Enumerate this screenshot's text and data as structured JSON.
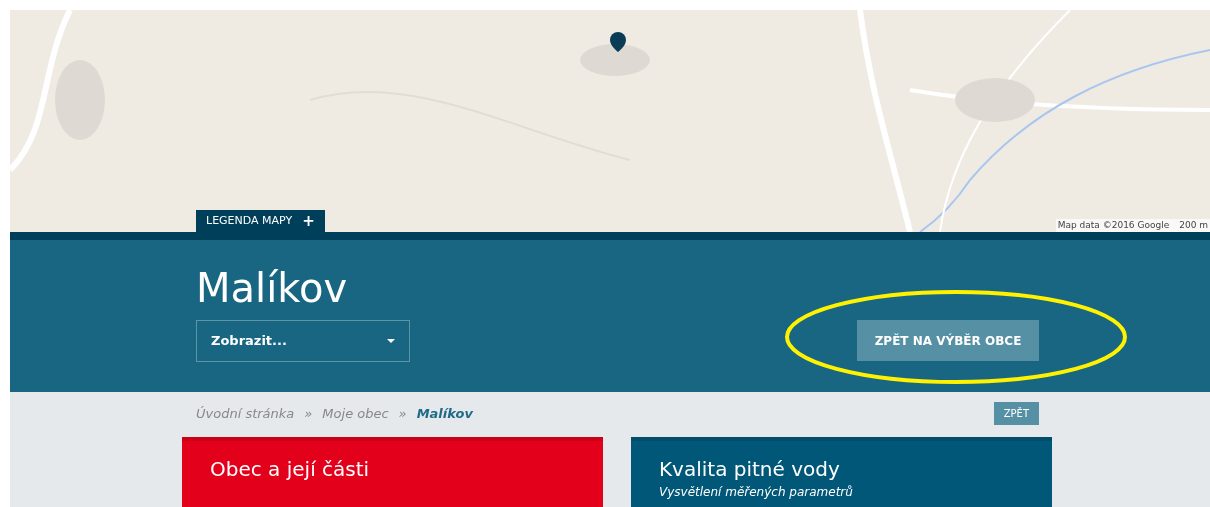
{
  "map": {
    "legend_tab": {
      "label": "LEGENDA MAPY",
      "icon": "+"
    },
    "attribution": "Map data ©2016 Google",
    "scale": "200 m"
  },
  "header": {
    "title": "Malíkov",
    "dropdown": {
      "value": "Zobrazit..."
    },
    "back_button": "ZPĚT NA VÝBĚR OBCE",
    "highlighted": true
  },
  "breadcrumb": {
    "items": [
      {
        "label": "Úvodní stránka",
        "current": false
      },
      {
        "label": "Moje obec",
        "current": false
      },
      {
        "label": "Malíkov",
        "current": true
      }
    ],
    "separator": "»",
    "back_button": "ZPĚT"
  },
  "cards": [
    {
      "title": "Obec a její části",
      "color": "#e2001a"
    },
    {
      "title": "Kvalita pitné vody",
      "subtitle": "Vysvětlení měřených parametrů",
      "color": "#005777"
    }
  ]
}
